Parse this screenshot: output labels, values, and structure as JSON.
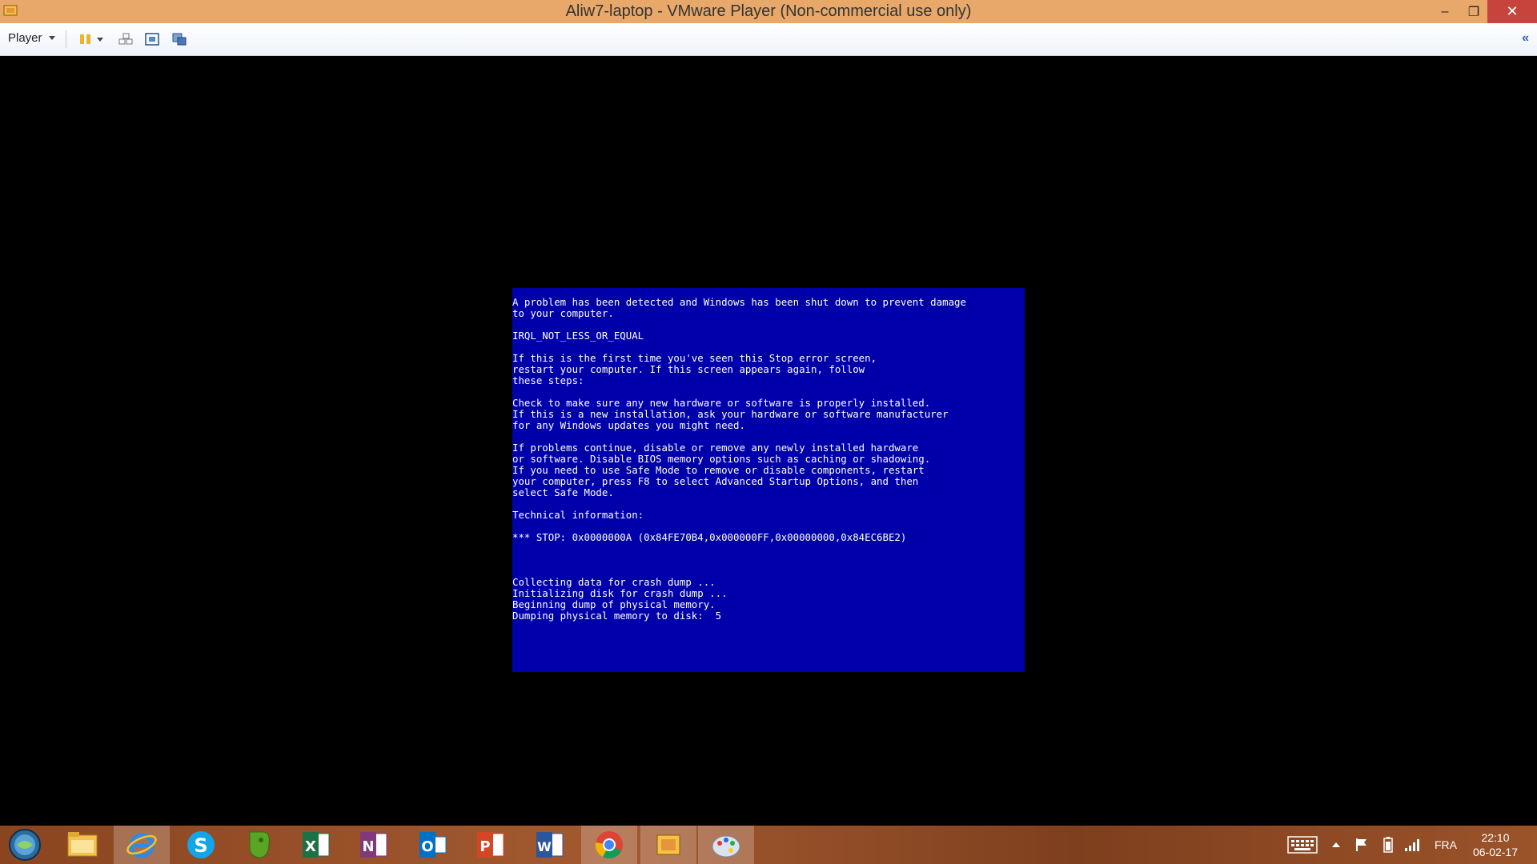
{
  "window": {
    "title": "Aliw7-laptop - VMware Player (Non-commercial use only)",
    "minimize": "–",
    "maximize": "❐",
    "close": "✕"
  },
  "toolbar": {
    "player_label": "Player",
    "collapse": "«"
  },
  "bsod": {
    "lines": [
      "A problem has been detected and Windows has been shut down to prevent damage",
      "to your computer.",
      "",
      "IRQL_NOT_LESS_OR_EQUAL",
      "",
      "If this is the first time you've seen this Stop error screen,",
      "restart your computer. If this screen appears again, follow",
      "these steps:",
      "",
      "Check to make sure any new hardware or software is properly installed.",
      "If this is a new installation, ask your hardware or software manufacturer",
      "for any Windows updates you might need.",
      "",
      "If problems continue, disable or remove any newly installed hardware",
      "or software. Disable BIOS memory options such as caching or shadowing.",
      "If you need to use Safe Mode to remove or disable components, restart",
      "your computer, press F8 to select Advanced Startup Options, and then",
      "select Safe Mode.",
      "",
      "Technical information:",
      "",
      "*** STOP: 0x0000000A (0x84FE70B4,0x000000FF,0x00000000,0x84EC6BE2)",
      "",
      "",
      "",
      "Collecting data for crash dump ...",
      "Initializing disk for crash dump ...",
      "Beginning dump of physical memory.",
      "Dumping physical memory to disk:  5"
    ]
  },
  "taskbar": {
    "apps": [
      {
        "name": "start-orb"
      },
      {
        "name": "file-explorer"
      },
      {
        "name": "internet-explorer"
      },
      {
        "name": "skype"
      },
      {
        "name": "evernote"
      },
      {
        "name": "excel"
      },
      {
        "name": "onenote"
      },
      {
        "name": "outlook"
      },
      {
        "name": "powerpoint"
      },
      {
        "name": "word"
      },
      {
        "name": "chrome"
      },
      {
        "name": "vmware-player"
      },
      {
        "name": "paint"
      }
    ],
    "language": "FRA",
    "time": "22:10",
    "date": "06-02-17"
  }
}
